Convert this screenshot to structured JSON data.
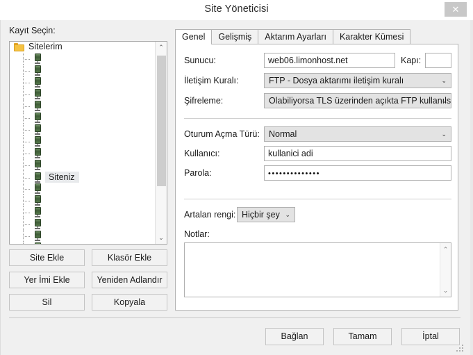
{
  "window": {
    "title": "Site Yöneticisi",
    "close_label": "✕"
  },
  "sidebar": {
    "tree_label": "Kayıt Seçin:",
    "root": {
      "label": "Sitelerim",
      "icon": "folder-icon"
    },
    "selected_node": "Siteniz",
    "nodes": [
      {
        "label": "",
        "selected": false
      },
      {
        "label": "",
        "selected": false
      },
      {
        "label": "",
        "selected": false
      },
      {
        "label": "",
        "selected": false
      },
      {
        "label": "",
        "selected": false
      },
      {
        "label": "",
        "selected": false
      },
      {
        "label": "",
        "selected": false
      },
      {
        "label": "",
        "selected": false
      },
      {
        "label": "",
        "selected": false
      },
      {
        "label": "",
        "selected": false
      },
      {
        "label": "Siteniz",
        "selected": true
      },
      {
        "label": "",
        "selected": false
      },
      {
        "label": "",
        "selected": false
      },
      {
        "label": "",
        "selected": false
      },
      {
        "label": "",
        "selected": false
      },
      {
        "label": "",
        "selected": false
      },
      {
        "label": "",
        "selected": false
      }
    ],
    "scrollbar": {
      "up_glyph": "⌃",
      "down_glyph": "⌄"
    },
    "buttons": {
      "add_site": "Site Ekle",
      "add_folder": "Klasör Ekle",
      "add_bookmark": "Yer İmi Ekle",
      "rename": "Yeniden Adlandır",
      "delete": "Sil",
      "duplicate": "Kopyala"
    }
  },
  "tabs": [
    {
      "label": "Genel",
      "active": true
    },
    {
      "label": "Gelişmiş",
      "active": false
    },
    {
      "label": "Aktarım Ayarları",
      "active": false
    },
    {
      "label": "Karakter Kümesi",
      "active": false
    }
  ],
  "general_tab": {
    "host_label": "Sunucu:",
    "host_value": "web06.limonhost.net",
    "port_label": "Kapı:",
    "port_value": "",
    "protocol_label": "İletişim Kuralı:",
    "protocol_value": "FTP - Dosya aktarımı iletişim kuralı",
    "encryption_label": "Şifreleme:",
    "encryption_value": "Olabiliyorsa TLS üzerinden açıkta FTP kullanılsın",
    "logontype_label": "Oturum Açma Türü:",
    "logontype_value": "Normal",
    "user_label": "Kullanıcı:",
    "user_value": "kullanici adi",
    "password_label": "Parola:",
    "password_value": "••••••••••••••",
    "bgcolor_label": "Artalan rengi:",
    "bgcolor_value": "Hiçbir şey",
    "notes_label": "Notlar:",
    "notes_value": "",
    "caret_glyph": "⌄",
    "scroll_up_glyph": "⌃",
    "scroll_down_glyph": "⌄"
  },
  "dialog_buttons": {
    "connect": "Bağlan",
    "ok": "Tamam",
    "cancel": "İptal"
  }
}
